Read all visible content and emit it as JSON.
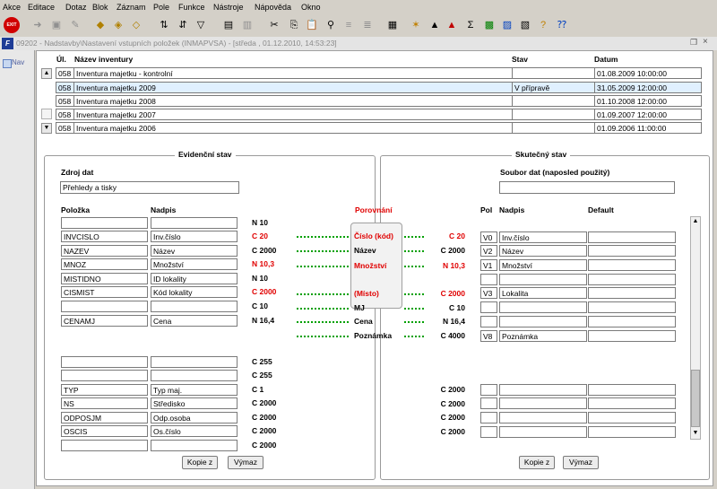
{
  "menu": [
    "Akce",
    "Editace",
    "Dotaz",
    "Blok",
    "Záznam",
    "Pole",
    "Funkce",
    "Nástroje",
    "Nápověda",
    "Okno"
  ],
  "toolbar": {
    "exit_label": "EXIT"
  },
  "window": {
    "title": "09202 - Nadstavby\\Nastavení vstupních položek (INMAPVSA) - [středa , 01.12.2010, 14:53:23]"
  },
  "sidebar": {
    "nav_label": "Nav"
  },
  "inventory": {
    "headers": {
      "ul": "Úl.",
      "name": "Název inventury",
      "stav": "Stav",
      "datum": "Datum"
    },
    "rows": [
      {
        "ul": "058",
        "name": "Inventura majetku - kontrolní",
        "stav": "",
        "datum": "01.08.2009 10:00:00"
      },
      {
        "ul": "058",
        "name": "Inventura majetku 2009",
        "stav": "V přípravě",
        "datum": "31.05.2009 12:00:00"
      },
      {
        "ul": "058",
        "name": "Inventura majetku 2008",
        "stav": "",
        "datum": "01.10.2008 12:00:00"
      },
      {
        "ul": "058",
        "name": "Inventura majetku 2007",
        "stav": "",
        "datum": "01.09.2007 12:00:00"
      },
      {
        "ul": "058",
        "name": "Inventura majetku 2006",
        "stav": "",
        "datum": "01.09.2006 11:00:00"
      }
    ]
  },
  "left": {
    "title": "Evidenční stav",
    "source_label": "Zdroj dat",
    "source_value": "Přehledy a tisky",
    "col_polozka": "Položka",
    "col_nadpis": "Nadpis",
    "rows": [
      {
        "p": "",
        "n": "",
        "t": "N 10",
        "red": false
      },
      {
        "p": "INVCISLO",
        "n": "Inv.číslo",
        "t": "C 20",
        "red": true
      },
      {
        "p": "NAZEV",
        "n": "Název",
        "t": "C 2000",
        "red": false
      },
      {
        "p": "MNOZ",
        "n": "Množství",
        "t": "N 10,3",
        "red": true
      },
      {
        "p": "MISTIDNO",
        "n": "ID lokality",
        "t": "N 10",
        "red": false
      },
      {
        "p": "CISMIST",
        "n": "Kód lokality",
        "t": "C 2000",
        "red": true
      },
      {
        "p": "",
        "n": "",
        "t": "C 10",
        "red": false
      },
      {
        "p": "CENAMJ",
        "n": "Cena",
        "t": "N 16,4",
        "red": false
      },
      {
        "p": "",
        "n": "",
        "t": "",
        "red": false
      },
      {
        "p": "",
        "n": "",
        "t": "C 255",
        "red": false
      },
      {
        "p": "",
        "n": "",
        "t": "C 255",
        "red": false
      },
      {
        "p": "TYP",
        "n": "Typ maj.",
        "t": "C 1",
        "red": false
      },
      {
        "p": "NS",
        "n": "Středisko",
        "t": "C 2000",
        "red": false
      },
      {
        "p": "ODPOSJM",
        "n": "Odp.osoba",
        "t": "C 2000",
        "red": false
      },
      {
        "p": "OSCIS",
        "n": "Os.číslo",
        "t": "C 2000",
        "red": false
      },
      {
        "p": "",
        "n": "",
        "t": "C 2000",
        "red": false
      }
    ],
    "copy_button": "Kopie z",
    "delete_button": "Výmaz"
  },
  "middle": {
    "title": "Porovnání",
    "rows": [
      {
        "label": "Číslo (kód)",
        "red": true,
        "type": "C 20",
        "type_red": true
      },
      {
        "label": "Název",
        "red": false,
        "type": "C 2000",
        "type_red": false
      },
      {
        "label": "Množství",
        "red": true,
        "type": "N 10,3",
        "type_red": true
      },
      {
        "label": "",
        "red": false,
        "type": "",
        "type_red": false
      },
      {
        "label": "(Místo)",
        "red": true,
        "type": "C 2000",
        "type_red": true
      },
      {
        "label": "MJ",
        "red": false,
        "type": "C 10",
        "type_red": false
      },
      {
        "label": "Cena",
        "red": false,
        "type": "N 16,4",
        "type_red": false
      },
      {
        "label": "Poznámka",
        "red": false,
        "type": "C 4000",
        "type_red": false
      }
    ],
    "extra_types": [
      "C 2000",
      "C 2000",
      "C 2000",
      "C 2000"
    ]
  },
  "right": {
    "title": "Skutečný stav",
    "source_label": "Soubor dat (naposled použitý)",
    "source_value": "",
    "col_pol": "Pol",
    "col_nadpis": "Nadpis",
    "col_default": "Default",
    "rows": [
      {
        "pol": "V0",
        "n": "Inv.číslo"
      },
      {
        "pol": "V2",
        "n": "Název"
      },
      {
        "pol": "V1",
        "n": "Množství"
      },
      {
        "pol": "",
        "n": ""
      },
      {
        "pol": "V3",
        "n": "Lokalita"
      },
      {
        "pol": "",
        "n": ""
      },
      {
        "pol": "",
        "n": ""
      },
      {
        "pol": "V8",
        "n": "Poznámka"
      }
    ],
    "copy_button": "Kopie z",
    "delete_button": "Výmaz"
  }
}
